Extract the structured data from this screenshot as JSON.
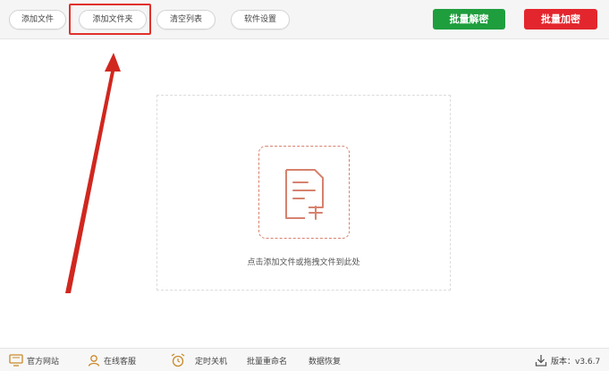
{
  "toolbar": {
    "add_file": "添加文件",
    "add_folder": "添加文件夹",
    "clear_list": "清空列表",
    "settings": "软件设置",
    "batch_decrypt": "批量解密",
    "batch_encrypt": "批量加密"
  },
  "drop_zone": {
    "hint": "点击添加文件或拖拽文件到此处"
  },
  "statusbar": {
    "official_site": "官方网站",
    "online_service": "在线客服",
    "scheduled_shutdown": "定时关机",
    "batch_rename": "批量重命名",
    "data_recovery": "数据恢复",
    "version_label": "版本：v3.6.7"
  },
  "colors": {
    "decrypt_green": "#1f9e3e",
    "encrypt_red": "#e3262d",
    "annotation_red": "#e0312b",
    "icon_red": "#d7826e"
  },
  "icons": [
    "monitor-icon",
    "user-icon",
    "alarm-clock-icon",
    "download-icon",
    "add-document-icon"
  ]
}
